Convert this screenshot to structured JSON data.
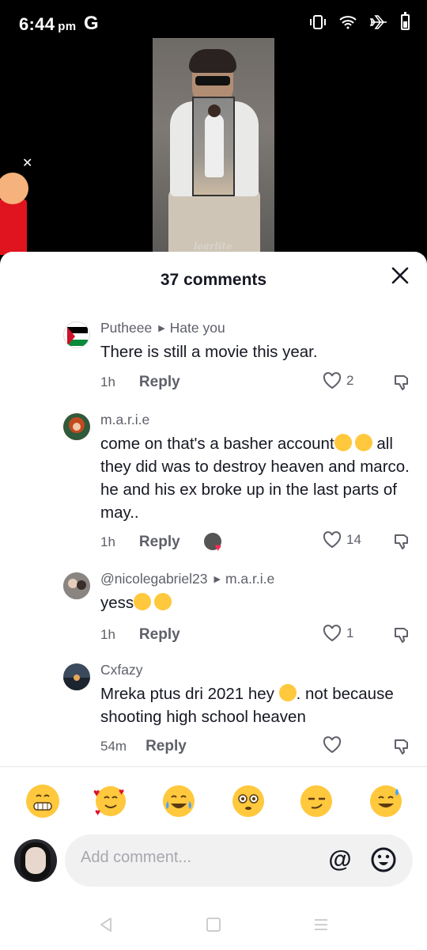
{
  "status_bar": {
    "time": "6:44",
    "ampm": "pm",
    "g": "G"
  },
  "video": {
    "caption": "learlite"
  },
  "sheet": {
    "title": "37 comments"
  },
  "comments": [
    {
      "author": "Putheee",
      "reply_to": "Hate you",
      "text": "There is still a movie this year.",
      "time": "1h",
      "reply_label": "Reply",
      "likes": "2"
    },
    {
      "author": "m.a.r.i.e",
      "reply_to": "",
      "text_line1": "come on that's a basher account",
      "text_rest": "all they did was to destroy heaven and marco. he and his ex broke up in the last parts of may..",
      "time": "1h",
      "reply_label": "Reply",
      "likes": "14"
    },
    {
      "author": "@nicolegabriel23",
      "reply_to": "m.a.r.i.e",
      "text": "yess",
      "time": "1h",
      "reply_label": "Reply",
      "likes": "1"
    },
    {
      "author": "Cxfazy",
      "reply_to": "",
      "text_part1": "Mreka ptus dri 2021 hey ",
      "text_part2": ". not because shooting high school heaven",
      "time": "54m",
      "reply_label": "Reply",
      "likes": ""
    }
  ],
  "quick_emojis": [
    "grinning-teeth",
    "smiling-hearts",
    "tears-of-joy",
    "flushed",
    "smirk",
    "sweat-smile"
  ],
  "composer": {
    "placeholder": "Add comment...",
    "at_symbol": "@"
  },
  "colors": {
    "text_primary": "#161823",
    "text_secondary": "#5e6069",
    "emoji_yellow": "#ffc83d"
  }
}
